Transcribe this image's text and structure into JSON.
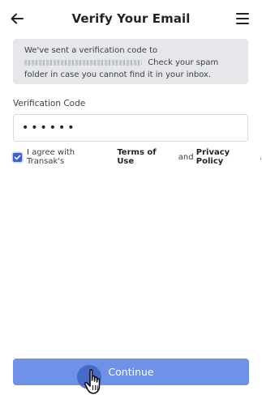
{
  "header": {
    "title": "Verify Your Email",
    "back_icon": "arrow-left-icon",
    "menu_icon": "hamburger-menu-icon"
  },
  "notice": {
    "prefix": "We've sent a verification code to",
    "suffix": "Check your spam folder in case you cannot find it in your inbox."
  },
  "verification": {
    "label": "Verification Code",
    "value": "••••••"
  },
  "agreement": {
    "checked": true,
    "text_prefix": "I agree with Transak's",
    "terms_label": "Terms of Use",
    "and_text": "and",
    "privacy_label": "Privacy Policy",
    "period": "."
  },
  "actions": {
    "continue_label": "Continue"
  },
  "colors": {
    "accent": "#3b5fd6",
    "button": "#6f91e8",
    "notice_bg": "#e6e7ea"
  }
}
